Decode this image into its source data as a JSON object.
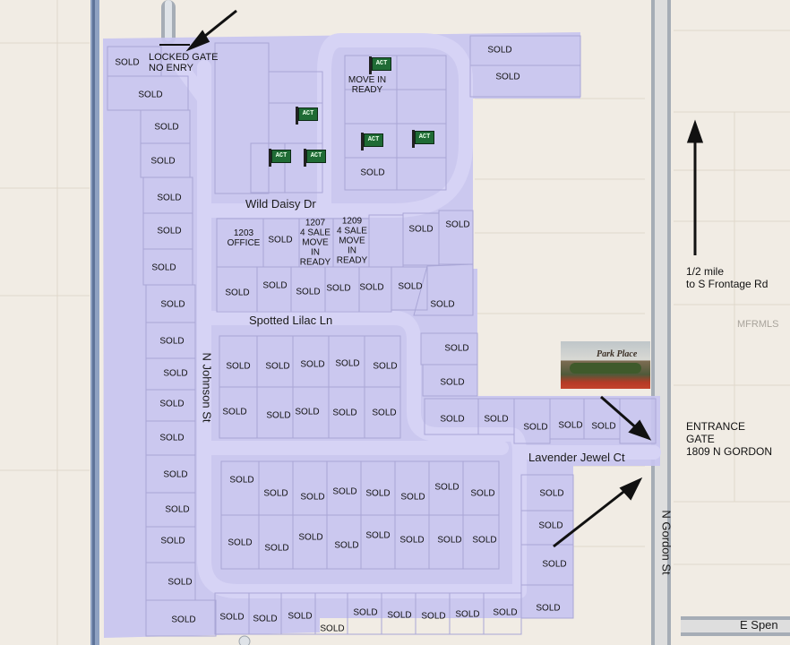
{
  "streets": {
    "wild_daisy": "Wild Daisy Dr",
    "spotted_lilac": "Spotted Lilac Ln",
    "n_johnson": "N Johnson St",
    "lavender_jewel": "Lavender Jewel Ct",
    "n_gordon": "N Gordon St",
    "e_spen": "E Spen"
  },
  "annotations": {
    "locked_gate": [
      "LOCKED GATE",
      "NO  ENRY"
    ],
    "half_mile": [
      "1/2 mile",
      "to S Frontage Rd"
    ],
    "entrance": [
      "ENTRANCE",
      "GATE",
      "1809 N GORDON"
    ],
    "mfrmls": "MFRMLS",
    "logo_text": "Park Place"
  },
  "sold_label": "SOLD",
  "act_label": "ACT",
  "special_lots": {
    "move_in_top": [
      "MOVE IN",
      "READY"
    ],
    "office": [
      "1203",
      "OFFICE"
    ],
    "lot_1207": [
      "1207",
      "4 SALE",
      "MOVE",
      "IN",
      "READY"
    ],
    "lot_1209": [
      "1209",
      "4 SALE",
      "MOVE",
      "IN",
      "READY"
    ]
  },
  "colors": {
    "subdivision": "#c8c4f0",
    "lot_lines": "#a9a6d6",
    "road": "#a6adb6",
    "land": "#f1ece4",
    "act_sign": "#1f6b35"
  }
}
